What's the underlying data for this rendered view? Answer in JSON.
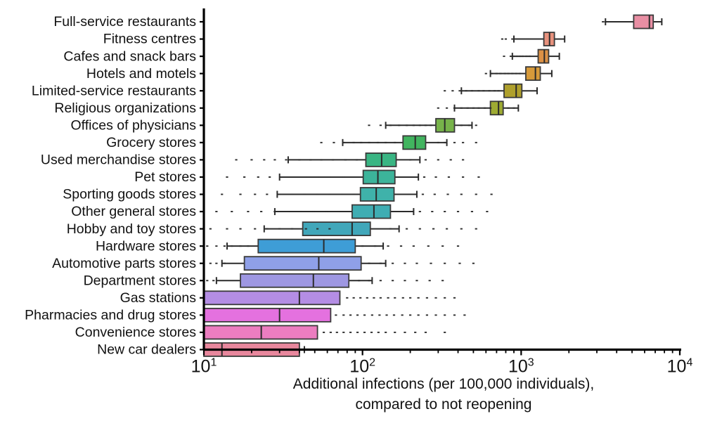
{
  "chart_data": {
    "type": "box",
    "title": "",
    "xlabel": "Additional infections (per 100,000 individuals), compared to not reopening",
    "xlabel_line1": "Additional infections (per 100,000 individuals),",
    "xlabel_line2": "compared to not reopening",
    "ylabel": "",
    "xscale": "log",
    "xlim": [
      10,
      10000
    ],
    "grid": false,
    "legend": false,
    "xticks": [
      10,
      100,
      1000,
      10000
    ],
    "xtick_labels": [
      "10¹",
      "10²",
      "10³",
      "10⁴"
    ],
    "xtick_mantissas": [
      "10",
      "10",
      "10",
      "10"
    ],
    "xtick_exponents": [
      "1",
      "2",
      "3",
      "4"
    ],
    "categories": [
      "Full-service restaurants",
      "Fitness centres",
      "Cafes and snack bars",
      "Hotels and motels",
      "Limited-service restaurants",
      "Religious organizations",
      "Offices of physicians",
      "Grocery stores",
      "Used merchandise stores",
      "Pet stores",
      "Sporting goods stores",
      "Other general stores",
      "Hobby and toy stores",
      "Hardware stores",
      "Automotive parts stores",
      "Department stores",
      "Gas stations",
      "Pharmacies and drug stores",
      "Convenience stores",
      "New car dealers"
    ],
    "boxes": [
      {
        "category": "Full-service restaurants",
        "color": "#E98FA4",
        "whisker_low": 3400,
        "q1": 5120,
        "median": 6430,
        "q3": 6800,
        "whisker_high": 7700,
        "fliers": [
          3280,
          3400,
          3520
        ]
      },
      {
        "category": "Fitness centres",
        "color": "#E8927E",
        "whisker_low": 900,
        "q1": 1390,
        "median": 1510,
        "q3": 1620,
        "whisker_high": 1880,
        "fliers": [
          760,
          800,
          880,
          920,
          960,
          1000,
          1040,
          1090
        ]
      },
      {
        "category": "Cafes and snack bars",
        "color": "#DC9145",
        "whisker_low": 880,
        "q1": 1280,
        "median": 1400,
        "q3": 1490,
        "whisker_high": 1740,
        "fliers": [
          780,
          860,
          900,
          940,
          980,
          1020,
          1080,
          1130
        ]
      },
      {
        "category": "Hotels and motels",
        "color": "#D79A3A",
        "whisker_low": 640,
        "q1": 1070,
        "median": 1230,
        "q3": 1320,
        "whisker_high": 1560,
        "fliers": [
          600,
          650,
          700,
          740,
          790,
          830,
          880,
          930,
          980
        ]
      },
      {
        "category": "Limited-service restaurants",
        "color": "#AFA02C",
        "whisker_low": 420,
        "q1": 780,
        "median": 930,
        "q3": 1010,
        "whisker_high": 1260,
        "fliers": [
          330,
          370,
          410,
          450,
          490,
          540,
          580,
          630,
          680,
          720
        ]
      },
      {
        "category": "Religious organizations",
        "color": "#9EAB32",
        "whisker_low": 380,
        "q1": 640,
        "median": 720,
        "q3": 770,
        "whisker_high": 960,
        "fliers": [
          300,
          340,
          380,
          420,
          460,
          500,
          540,
          590,
          640,
          830,
          900
        ]
      },
      {
        "category": "Offices of physicians",
        "color": "#77B34A",
        "whisker_low": 140,
        "q1": 290,
        "median": 330,
        "q3": 380,
        "whisker_high": 490,
        "fliers": [
          110,
          130,
          150,
          170,
          190,
          210,
          230,
          250,
          270,
          420,
          470,
          520
        ]
      },
      {
        "category": "Grocery stores",
        "color": "#41B45F",
        "whisker_low": 75,
        "q1": 180,
        "median": 215,
        "q3": 250,
        "whisker_high": 340,
        "fliers": [
          55,
          66,
          76,
          88,
          98,
          110,
          125,
          140,
          160,
          300,
          330,
          380,
          430,
          520
        ]
      },
      {
        "category": "Used merchandise stores",
        "color": "#39B583",
        "whisker_low": 34,
        "q1": 105,
        "median": 132,
        "q3": 163,
        "whisker_high": 230,
        "fliers": [
          16,
          20,
          24,
          28,
          33,
          40,
          47,
          55,
          65,
          78,
          92,
          200,
          250,
          300,
          360,
          430
        ]
      },
      {
        "category": "Pet stores",
        "color": "#3CB49A",
        "whisker_low": 30,
        "q1": 101,
        "median": 125,
        "q3": 160,
        "whisker_high": 225,
        "fliers": [
          14,
          18,
          22,
          26,
          31,
          38,
          45,
          54,
          64,
          76,
          90,
          200,
          245,
          290,
          350,
          430,
          540
        ]
      },
      {
        "category": "Sporting goods stores",
        "color": "#3FB2AA",
        "whisker_low": 29,
        "q1": 97,
        "median": 122,
        "q3": 158,
        "whisker_high": 220,
        "fliers": [
          13,
          17,
          21,
          25,
          30,
          36,
          43,
          52,
          62,
          74,
          88,
          195,
          240,
          285,
          345,
          420,
          520,
          650
        ]
      },
      {
        "category": "Other general stores",
        "color": "#3FADB3",
        "whisker_low": 28,
        "q1": 86,
        "median": 118,
        "q3": 150,
        "whisker_high": 210,
        "fliers": [
          12,
          15,
          19,
          23,
          28,
          34,
          41,
          49,
          59,
          70,
          84,
          185,
          230,
          275,
          330,
          400,
          490,
          610
        ]
      },
      {
        "category": "Hobby and toy stores",
        "color": "#41A7BA",
        "whisker_low": 24,
        "q1": 42,
        "median": 86,
        "q3": 112,
        "whisker_high": 170,
        "fliers": [
          11,
          14,
          17,
          21,
          25,
          30,
          36,
          44,
          52,
          62,
          150,
          190,
          230,
          280,
          340,
          420,
          520
        ]
      },
      {
        "category": "Hardware stores",
        "color": "#3E9DD6",
        "whisker_low": 14,
        "q1": 22,
        "median": 57,
        "q3": 90,
        "whisker_high": 135,
        "fliers": [
          10.5,
          12,
          13.5,
          15,
          17,
          19,
          100,
          120,
          145,
          175,
          210,
          260,
          320,
          400
        ]
      },
      {
        "category": "Automotive parts stores",
        "color": "#8FA0E8",
        "whisker_low": 13,
        "q1": 18,
        "median": 53,
        "q3": 98,
        "whisker_high": 140,
        "fliers": [
          11,
          12,
          13.5,
          110,
          130,
          155,
          185,
          220,
          270,
          330,
          410,
          500
        ]
      },
      {
        "category": "Department stores",
        "color": "#9E97E2",
        "whisker_low": 12,
        "q1": 17,
        "median": 49,
        "q3": 82,
        "whisker_high": 115,
        "fliers": [
          10.5,
          11.5,
          95,
          110,
          130,
          155,
          185,
          220,
          265,
          320
        ]
      },
      {
        "category": "Gas stations",
        "color": "#B48DE4",
        "whisker_low": 10,
        "q1": 10,
        "median": 40,
        "q3": 72,
        "whisker_high": 72,
        "fliers": [
          80,
          88,
          97,
          107,
          118,
          130,
          145,
          160,
          180,
          200,
          225,
          255,
          290,
          330,
          380
        ]
      },
      {
        "category": "Pharmacies and drug stores",
        "color": "#E471DF",
        "whisker_low": 10,
        "q1": 10,
        "median": 30,
        "q3": 63,
        "whisker_high": 63,
        "fliers": [
          68,
          76,
          84,
          93,
          103,
          115,
          128,
          142,
          158,
          178,
          200,
          225,
          255,
          290,
          330,
          380,
          440
        ]
      },
      {
        "category": "Convenience stores",
        "color": "#EC7DC0",
        "whisker_low": 10,
        "q1": 10,
        "median": 23,
        "q3": 52,
        "whisker_high": 52,
        "fliers": [
          57,
          63,
          69,
          76,
          84,
          93,
          103,
          114,
          126,
          140,
          160,
          185,
          215,
          250,
          330
        ]
      },
      {
        "category": "New car dealers",
        "color": "#E8879D",
        "whisker_low": 10,
        "q1": 10,
        "median": 13,
        "q3": 40,
        "whisker_high": 43,
        "fliers": [
          48,
          53,
          59,
          65,
          72,
          80,
          88,
          98,
          108,
          120,
          134,
          150,
          170,
          195,
          290
        ]
      }
    ]
  },
  "axes": {
    "x_tick_values": [
      10,
      100,
      1000,
      10000
    ],
    "x_minor_ticks": [
      20,
      30,
      40,
      50,
      60,
      70,
      80,
      90,
      200,
      300,
      400,
      500,
      600,
      700,
      800,
      900,
      2000,
      3000,
      4000,
      5000,
      6000,
      7000,
      8000,
      9000
    ]
  }
}
